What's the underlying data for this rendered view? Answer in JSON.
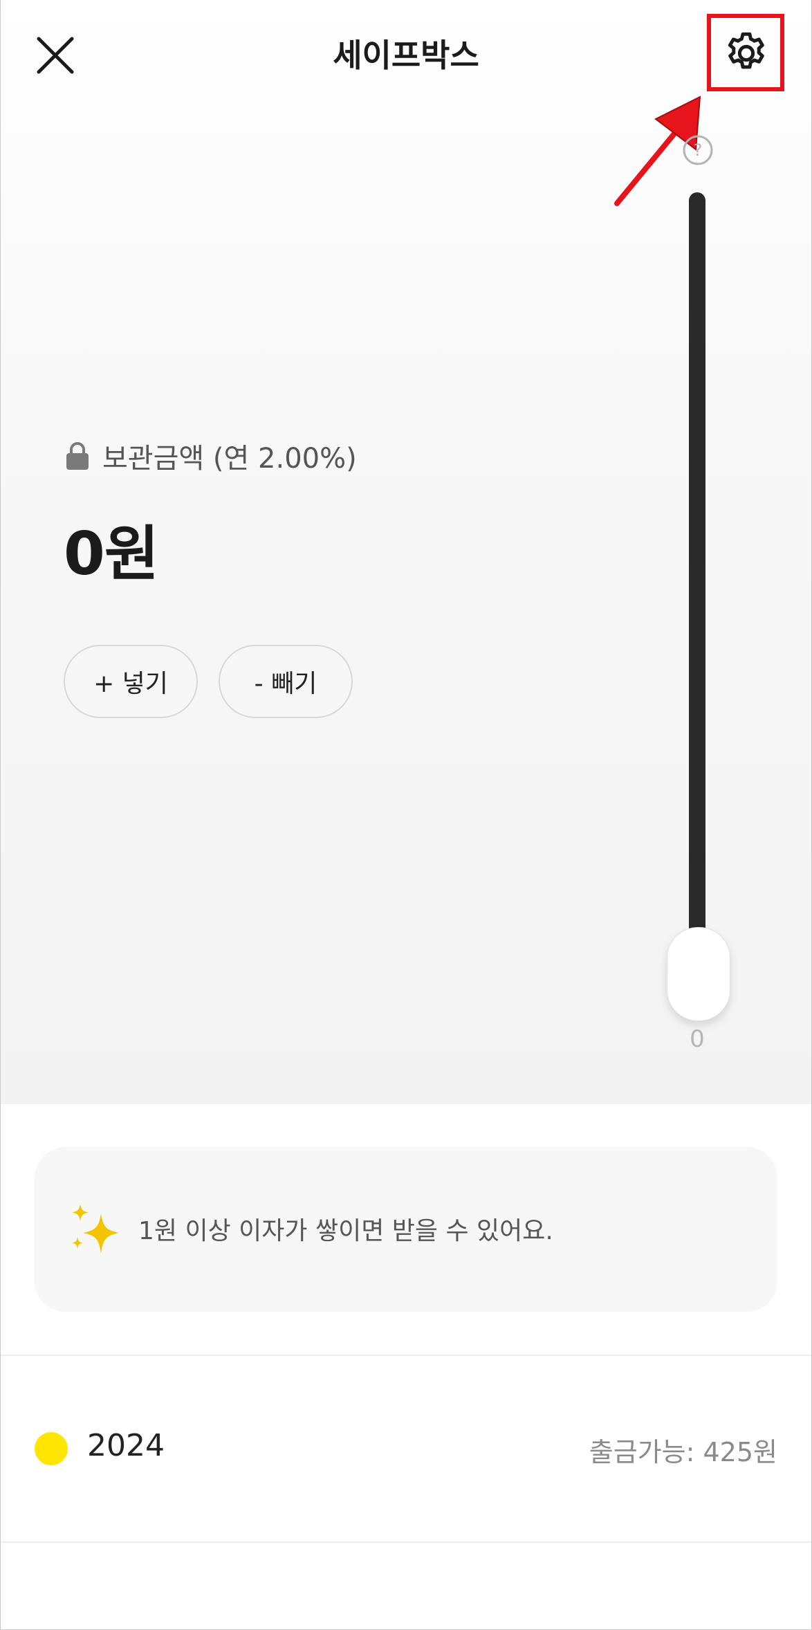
{
  "header": {
    "title": "세이프박스",
    "close_icon": "close-icon",
    "settings_icon": "gear-icon",
    "highlight_color": "#e8141c"
  },
  "balance": {
    "label": "보관금액 (연 2.00%)",
    "amount": "0원",
    "lock_icon": "lock-icon"
  },
  "actions": {
    "add_label": "+ 넣기",
    "withdraw_label": "- 빼기"
  },
  "slider": {
    "value_label": "0",
    "level": 0,
    "help_icon": "question-circle-icon"
  },
  "info": {
    "icon": "sparkle-icon",
    "text": "1원 이상 이자가 쌓이면 받을 수 있어요."
  },
  "history": {
    "items": [
      {
        "year": "2024",
        "available": "출금가능: 425원",
        "dot_color": "#ffe500"
      }
    ]
  }
}
